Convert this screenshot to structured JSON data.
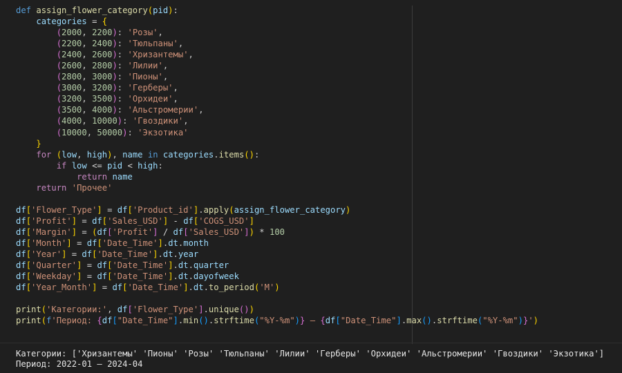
{
  "code_lines": [
    [
      [
        "kw",
        "def "
      ],
      [
        "fn",
        "assign_flower_category"
      ],
      [
        "p1",
        "("
      ],
      [
        "var",
        "pid"
      ],
      [
        "p1",
        ")"
      ],
      [
        "plain",
        ":"
      ]
    ],
    [
      [
        "plain",
        "    "
      ],
      [
        "var",
        "categories"
      ],
      [
        "op",
        " = "
      ],
      [
        "p1",
        "{"
      ]
    ],
    [
      [
        "plain",
        "        "
      ],
      [
        "p2",
        "("
      ],
      [
        "num",
        "2000"
      ],
      [
        "plain",
        ", "
      ],
      [
        "num",
        "2200"
      ],
      [
        "p2",
        ")"
      ],
      [
        "plain",
        ": "
      ],
      [
        "str",
        "'Розы'"
      ],
      [
        "plain",
        ","
      ]
    ],
    [
      [
        "plain",
        "        "
      ],
      [
        "p2",
        "("
      ],
      [
        "num",
        "2200"
      ],
      [
        "plain",
        ", "
      ],
      [
        "num",
        "2400"
      ],
      [
        "p2",
        ")"
      ],
      [
        "plain",
        ": "
      ],
      [
        "str",
        "'Тюльпаны'"
      ],
      [
        "plain",
        ","
      ]
    ],
    [
      [
        "plain",
        "        "
      ],
      [
        "p2",
        "("
      ],
      [
        "num",
        "2400"
      ],
      [
        "plain",
        ", "
      ],
      [
        "num",
        "2600"
      ],
      [
        "p2",
        ")"
      ],
      [
        "plain",
        ": "
      ],
      [
        "str",
        "'Хризантемы'"
      ],
      [
        "plain",
        ","
      ]
    ],
    [
      [
        "plain",
        "        "
      ],
      [
        "p2",
        "("
      ],
      [
        "num",
        "2600"
      ],
      [
        "plain",
        ", "
      ],
      [
        "num",
        "2800"
      ],
      [
        "p2",
        ")"
      ],
      [
        "plain",
        ": "
      ],
      [
        "str",
        "'Лилии'"
      ],
      [
        "plain",
        ","
      ]
    ],
    [
      [
        "plain",
        "        "
      ],
      [
        "p2",
        "("
      ],
      [
        "num",
        "2800"
      ],
      [
        "plain",
        ", "
      ],
      [
        "num",
        "3000"
      ],
      [
        "p2",
        ")"
      ],
      [
        "plain",
        ": "
      ],
      [
        "str",
        "'Пионы'"
      ],
      [
        "plain",
        ","
      ]
    ],
    [
      [
        "plain",
        "        "
      ],
      [
        "p2",
        "("
      ],
      [
        "num",
        "3000"
      ],
      [
        "plain",
        ", "
      ],
      [
        "num",
        "3200"
      ],
      [
        "p2",
        ")"
      ],
      [
        "plain",
        ": "
      ],
      [
        "str",
        "'Герберы'"
      ],
      [
        "plain",
        ","
      ]
    ],
    [
      [
        "plain",
        "        "
      ],
      [
        "p2",
        "("
      ],
      [
        "num",
        "3200"
      ],
      [
        "plain",
        ", "
      ],
      [
        "num",
        "3500"
      ],
      [
        "p2",
        ")"
      ],
      [
        "plain",
        ": "
      ],
      [
        "str",
        "'Орхидеи'"
      ],
      [
        "plain",
        ","
      ]
    ],
    [
      [
        "plain",
        "        "
      ],
      [
        "p2",
        "("
      ],
      [
        "num",
        "3500"
      ],
      [
        "plain",
        ", "
      ],
      [
        "num",
        "4000"
      ],
      [
        "p2",
        ")"
      ],
      [
        "plain",
        ": "
      ],
      [
        "str",
        "'Альстромерии'"
      ],
      [
        "plain",
        ","
      ]
    ],
    [
      [
        "plain",
        "        "
      ],
      [
        "p2",
        "("
      ],
      [
        "num",
        "4000"
      ],
      [
        "plain",
        ", "
      ],
      [
        "num",
        "10000"
      ],
      [
        "p2",
        ")"
      ],
      [
        "plain",
        ": "
      ],
      [
        "str",
        "'Гвоздики'"
      ],
      [
        "plain",
        ","
      ]
    ],
    [
      [
        "plain",
        "        "
      ],
      [
        "p2",
        "("
      ],
      [
        "num",
        "10000"
      ],
      [
        "plain",
        ", "
      ],
      [
        "num",
        "50000"
      ],
      [
        "p2",
        ")"
      ],
      [
        "plain",
        ": "
      ],
      [
        "str",
        "'Экзотика'"
      ]
    ],
    [
      [
        "plain",
        "    "
      ],
      [
        "p1",
        "}"
      ]
    ],
    [
      [
        "plain",
        "    "
      ],
      [
        "ctl",
        "for "
      ],
      [
        "p1",
        "("
      ],
      [
        "var",
        "low"
      ],
      [
        "plain",
        ", "
      ],
      [
        "var",
        "high"
      ],
      [
        "p1",
        ")"
      ],
      [
        "plain",
        ", "
      ],
      [
        "var",
        "name"
      ],
      [
        "kw",
        " in "
      ],
      [
        "var",
        "categories"
      ],
      [
        "plain",
        "."
      ],
      [
        "fn",
        "items"
      ],
      [
        "p1",
        "()"
      ],
      [
        "plain",
        ":"
      ]
    ],
    [
      [
        "plain",
        "        "
      ],
      [
        "ctl",
        "if "
      ],
      [
        "var",
        "low"
      ],
      [
        "op",
        " <= "
      ],
      [
        "var",
        "pid"
      ],
      [
        "op",
        " < "
      ],
      [
        "var",
        "high"
      ],
      [
        "plain",
        ":"
      ]
    ],
    [
      [
        "plain",
        "            "
      ],
      [
        "ctl",
        "return "
      ],
      [
        "var",
        "name"
      ]
    ],
    [
      [
        "plain",
        "    "
      ],
      [
        "ctl",
        "return "
      ],
      [
        "str",
        "'Прочее'"
      ]
    ],
    [],
    [
      [
        "var",
        "df"
      ],
      [
        "p1",
        "["
      ],
      [
        "str",
        "'Flower_Type'"
      ],
      [
        "p1",
        "]"
      ],
      [
        "op",
        " = "
      ],
      [
        "var",
        "df"
      ],
      [
        "p1",
        "["
      ],
      [
        "str",
        "'Product_id'"
      ],
      [
        "p1",
        "]"
      ],
      [
        "plain",
        "."
      ],
      [
        "fn",
        "apply"
      ],
      [
        "p1",
        "("
      ],
      [
        "var",
        "assign_flower_category"
      ],
      [
        "p1",
        ")"
      ]
    ],
    [
      [
        "var",
        "df"
      ],
      [
        "p1",
        "["
      ],
      [
        "str",
        "'Profit'"
      ],
      [
        "p1",
        "]"
      ],
      [
        "op",
        " = "
      ],
      [
        "var",
        "df"
      ],
      [
        "p1",
        "["
      ],
      [
        "str",
        "'Sales_USD'"
      ],
      [
        "p1",
        "]"
      ],
      [
        "op",
        " - "
      ],
      [
        "var",
        "df"
      ],
      [
        "p1",
        "["
      ],
      [
        "str",
        "'COGS_USD'"
      ],
      [
        "p1",
        "]"
      ]
    ],
    [
      [
        "var",
        "df"
      ],
      [
        "p1",
        "["
      ],
      [
        "str",
        "'Margin'"
      ],
      [
        "p1",
        "]"
      ],
      [
        "op",
        " = "
      ],
      [
        "p1",
        "("
      ],
      [
        "var",
        "df"
      ],
      [
        "p2",
        "["
      ],
      [
        "str",
        "'Profit'"
      ],
      [
        "p2",
        "]"
      ],
      [
        "op",
        " / "
      ],
      [
        "var",
        "df"
      ],
      [
        "p2",
        "["
      ],
      [
        "str",
        "'Sales_USD'"
      ],
      [
        "p2",
        "]"
      ],
      [
        "p1",
        ")"
      ],
      [
        "op",
        " * "
      ],
      [
        "num",
        "100"
      ]
    ],
    [
      [
        "var",
        "df"
      ],
      [
        "p1",
        "["
      ],
      [
        "str",
        "'Month'"
      ],
      [
        "p1",
        "]"
      ],
      [
        "op",
        " = "
      ],
      [
        "var",
        "df"
      ],
      [
        "p1",
        "["
      ],
      [
        "str",
        "'Date_Time'"
      ],
      [
        "p1",
        "]"
      ],
      [
        "plain",
        "."
      ],
      [
        "var",
        "dt"
      ],
      [
        "plain",
        "."
      ],
      [
        "var",
        "month"
      ]
    ],
    [
      [
        "var",
        "df"
      ],
      [
        "p1",
        "["
      ],
      [
        "str",
        "'Year'"
      ],
      [
        "p1",
        "]"
      ],
      [
        "op",
        " = "
      ],
      [
        "var",
        "df"
      ],
      [
        "p1",
        "["
      ],
      [
        "str",
        "'Date_Time'"
      ],
      [
        "p1",
        "]"
      ],
      [
        "plain",
        "."
      ],
      [
        "var",
        "dt"
      ],
      [
        "plain",
        "."
      ],
      [
        "var",
        "year"
      ]
    ],
    [
      [
        "var",
        "df"
      ],
      [
        "p1",
        "["
      ],
      [
        "str",
        "'Quarter'"
      ],
      [
        "p1",
        "]"
      ],
      [
        "op",
        " = "
      ],
      [
        "var",
        "df"
      ],
      [
        "p1",
        "["
      ],
      [
        "str",
        "'Date_Time'"
      ],
      [
        "p1",
        "]"
      ],
      [
        "plain",
        "."
      ],
      [
        "var",
        "dt"
      ],
      [
        "plain",
        "."
      ],
      [
        "var",
        "quarter"
      ]
    ],
    [
      [
        "var",
        "df"
      ],
      [
        "p1",
        "["
      ],
      [
        "str",
        "'Weekday'"
      ],
      [
        "p1",
        "]"
      ],
      [
        "op",
        " = "
      ],
      [
        "var",
        "df"
      ],
      [
        "p1",
        "["
      ],
      [
        "str",
        "'Date_Time'"
      ],
      [
        "p1",
        "]"
      ],
      [
        "plain",
        "."
      ],
      [
        "var",
        "dt"
      ],
      [
        "plain",
        "."
      ],
      [
        "var",
        "dayofweek"
      ]
    ],
    [
      [
        "var",
        "df"
      ],
      [
        "p1",
        "["
      ],
      [
        "str",
        "'Year_Month'"
      ],
      [
        "p1",
        "]"
      ],
      [
        "op",
        " = "
      ],
      [
        "var",
        "df"
      ],
      [
        "p1",
        "["
      ],
      [
        "str",
        "'Date_Time'"
      ],
      [
        "p1",
        "]"
      ],
      [
        "plain",
        "."
      ],
      [
        "var",
        "dt"
      ],
      [
        "plain",
        "."
      ],
      [
        "fn",
        "to_period"
      ],
      [
        "p1",
        "("
      ],
      [
        "str",
        "'M'"
      ],
      [
        "p1",
        ")"
      ]
    ],
    [],
    [
      [
        "fn",
        "print"
      ],
      [
        "p1",
        "("
      ],
      [
        "str",
        "'Категории:'"
      ],
      [
        "plain",
        ", "
      ],
      [
        "var",
        "df"
      ],
      [
        "p2",
        "["
      ],
      [
        "str",
        "'Flower_Type'"
      ],
      [
        "p2",
        "]"
      ],
      [
        "plain",
        "."
      ],
      [
        "fn",
        "unique"
      ],
      [
        "p2",
        "()"
      ],
      [
        "p1",
        ")"
      ]
    ],
    [
      [
        "fn",
        "print"
      ],
      [
        "p1",
        "("
      ],
      [
        "kw",
        "f"
      ],
      [
        "str",
        "'Период: "
      ],
      [
        "p2",
        "{"
      ],
      [
        "var",
        "df"
      ],
      [
        "p3",
        "["
      ],
      [
        "str",
        "\"Date_Time\""
      ],
      [
        "p3",
        "]"
      ],
      [
        "plain",
        "."
      ],
      [
        "fn",
        "min"
      ],
      [
        "p3",
        "()"
      ],
      [
        "plain",
        "."
      ],
      [
        "fn",
        "strftime"
      ],
      [
        "p3",
        "("
      ],
      [
        "str",
        "\"%Y-%m\""
      ],
      [
        "p3",
        ")"
      ],
      [
        "p2",
        "}"
      ],
      [
        "str",
        " – "
      ],
      [
        "p2",
        "{"
      ],
      [
        "var",
        "df"
      ],
      [
        "p3",
        "["
      ],
      [
        "str",
        "\"Date_Time\""
      ],
      [
        "p3",
        "]"
      ],
      [
        "plain",
        "."
      ],
      [
        "fn",
        "max"
      ],
      [
        "p3",
        "()"
      ],
      [
        "plain",
        "."
      ],
      [
        "fn",
        "strftime"
      ],
      [
        "p3",
        "("
      ],
      [
        "str",
        "\"%Y-%m\""
      ],
      [
        "p3",
        ")"
      ],
      [
        "p2",
        "}"
      ],
      [
        "str",
        "'"
      ],
      [
        "p1",
        ")"
      ]
    ]
  ],
  "output_lines": [
    "Категории: ['Хризантемы' 'Пионы' 'Розы' 'Тюльпаны' 'Лилии' 'Герберы' 'Орхидеи' 'Альстромерии' 'Гвоздики' 'Экзотика']",
    "Период: 2022-01 – 2024-04"
  ]
}
